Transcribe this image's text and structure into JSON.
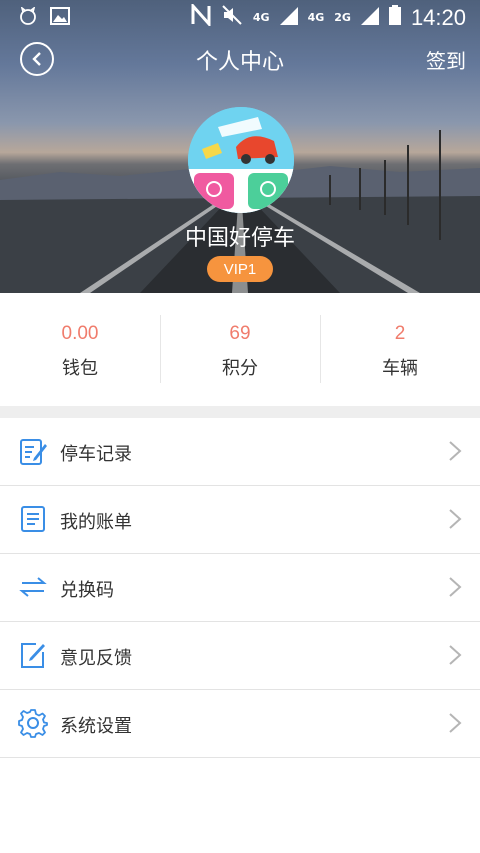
{
  "status_bar": {
    "time": "14:20",
    "network_1": "4G",
    "network_2": "4G",
    "network_3": "2G"
  },
  "header": {
    "title": "个人中心",
    "checkin_label": "签到"
  },
  "profile": {
    "name": "中国好停车",
    "vip_badge": "VIP1"
  },
  "stats": [
    {
      "value": "0.00",
      "label": "钱包"
    },
    {
      "value": "69",
      "label": "积分"
    },
    {
      "value": "2",
      "label": "车辆"
    }
  ],
  "menu": [
    {
      "label": "停车记录",
      "icon": "parking-record-icon"
    },
    {
      "label": "我的账单",
      "icon": "bill-icon"
    },
    {
      "label": "兑换码",
      "icon": "exchange-icon"
    },
    {
      "label": "意见反馈",
      "icon": "feedback-icon"
    },
    {
      "label": "系统设置",
      "icon": "settings-gear-icon"
    }
  ],
  "colors": {
    "accent": "#f07c6c",
    "vip": "#f6943e",
    "icon_blue": "#3a8ee6"
  }
}
